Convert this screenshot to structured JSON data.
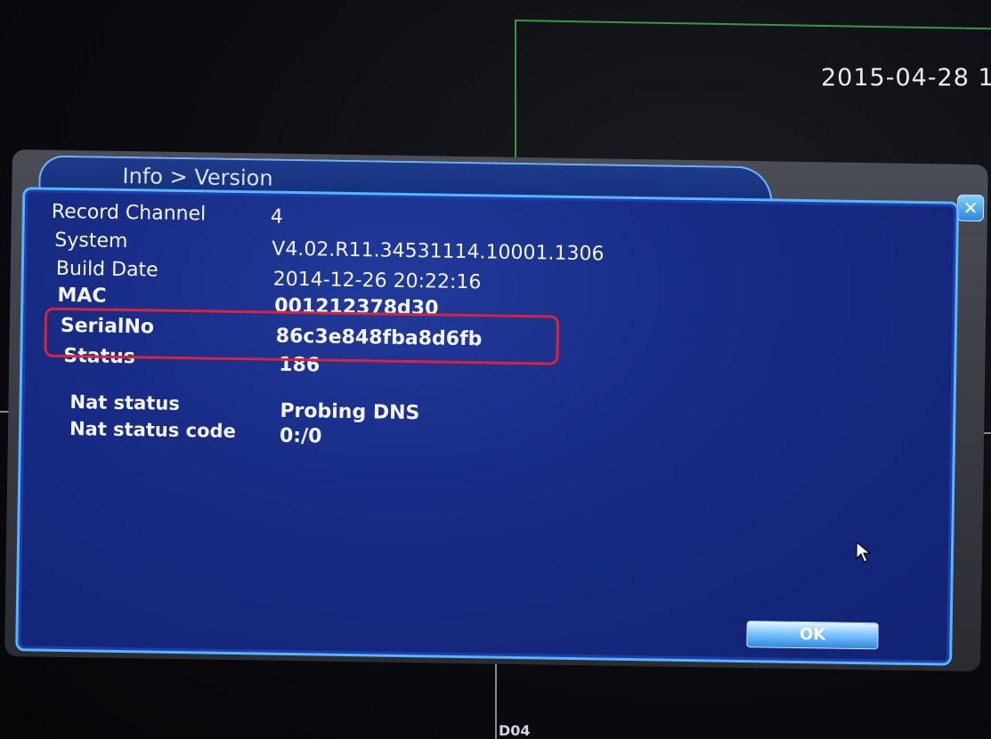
{
  "screen": {
    "datetime": "2015-04-28 1",
    "channel_label": "D04"
  },
  "dialog": {
    "title": "Info > Version",
    "close_icon": "close-x",
    "ok_label": "OK",
    "rows": [
      {
        "label": "Record Channel",
        "value": "4"
      },
      {
        "label": "System",
        "value": "V4.02.R11.34531114.10001.1306"
      },
      {
        "label": "Build Date",
        "value": "2014-12-26 20:22:16"
      },
      {
        "label": "MAC",
        "value": "001212378d30"
      },
      {
        "label": "SerialNo",
        "value": "86c3e848fba8d6fb"
      },
      {
        "label": "Status",
        "value": "186"
      }
    ],
    "nat_rows": [
      {
        "label": "Nat status",
        "value": "Probing DNS"
      },
      {
        "label": "Nat status code",
        "value": "0:/0"
      }
    ]
  },
  "colors": {
    "panel_blue": "#182c86",
    "panel_border": "#58b4ff",
    "highlight_red": "#d8243a",
    "grid_green": "#3fb04a"
  },
  "icons": {
    "close": "close-icon",
    "cursor": "mouse-cursor-icon"
  }
}
